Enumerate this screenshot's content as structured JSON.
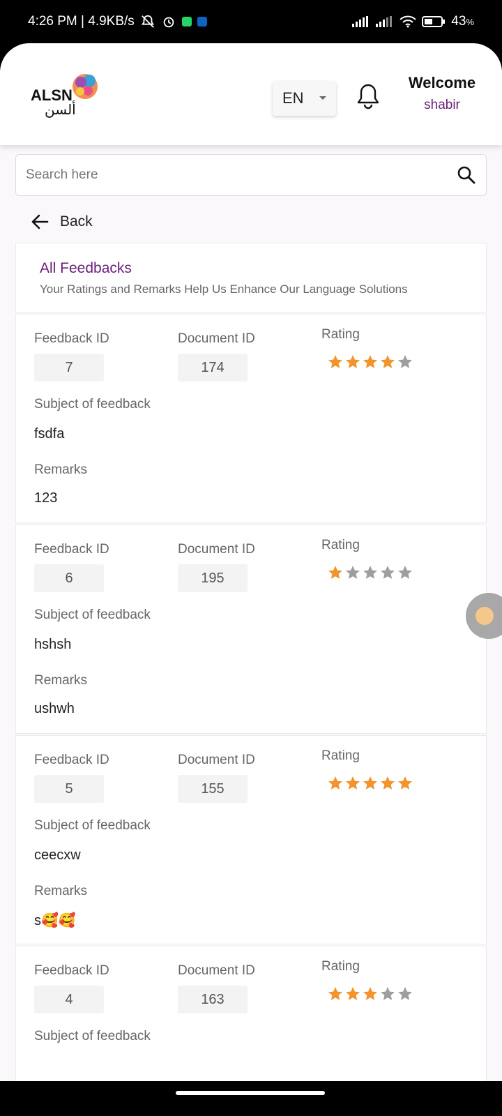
{
  "status_bar": {
    "time_speed": "4:26 PM | 4.9KB/s",
    "battery": "43",
    "battery_unit": "%"
  },
  "header": {
    "logo_text": "ALSN",
    "logo_arabic": "ألسن",
    "language": "EN",
    "welcome": "Welcome",
    "username": "shabir"
  },
  "search": {
    "placeholder": "Search here"
  },
  "nav": {
    "back_label": "Back"
  },
  "intro": {
    "title": "All Feedbacks",
    "subtitle": "Your Ratings and Remarks Help Us Enhance Our Language Solutions"
  },
  "labels": {
    "feedback_id": "Feedback ID",
    "document_id": "Document ID",
    "rating": "Rating",
    "subject": "Subject of feedback",
    "remarks": "Remarks"
  },
  "colors": {
    "accent": "#6b1d7a",
    "star_filled": "#f2932b",
    "star_empty": "#9e9e9e"
  },
  "feedbacks": [
    {
      "feedback_id": "7",
      "document_id": "174",
      "rating": 4,
      "subject": "fsdfa",
      "remarks": "123"
    },
    {
      "feedback_id": "6",
      "document_id": "195",
      "rating": 1,
      "subject": "hshsh",
      "remarks": "ushwh"
    },
    {
      "feedback_id": "5",
      "document_id": "155",
      "rating": 5,
      "subject": "ceecxw",
      "remarks": "s🥰🥰"
    },
    {
      "feedback_id": "4",
      "document_id": "163",
      "rating": 3,
      "subject": "",
      "remarks": ""
    }
  ]
}
